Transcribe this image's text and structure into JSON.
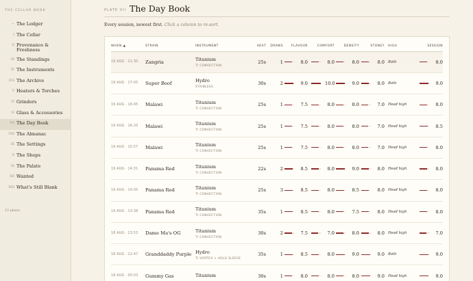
{
  "brand": "THE CELLAR BOOK",
  "nav": [
    {
      "num": "—",
      "label": "The Ledger"
    },
    {
      "num": "I",
      "label": "The Cellar"
    },
    {
      "num": "II",
      "label": "Provenance & Freshness"
    },
    {
      "num": "III",
      "label": "The Standings"
    },
    {
      "num": "IV",
      "label": "The Instruments"
    },
    {
      "num": "IVS",
      "label": "The Archive"
    },
    {
      "num": "V",
      "label": "Heaters & Torches"
    },
    {
      "num": "VI",
      "label": "Grinders"
    },
    {
      "num": "VI",
      "label": "Glass & Accessories"
    },
    {
      "num": "VII",
      "label": "The Day Book",
      "active": true
    },
    {
      "num": "VIII",
      "label": "The Almanac"
    },
    {
      "num": "IX",
      "label": "The Settings"
    },
    {
      "num": "X",
      "label": "The Shops"
    },
    {
      "num": "XI",
      "label": "The Palate"
    },
    {
      "num": "XII",
      "label": "Wanted"
    },
    {
      "num": "XIII",
      "label": "What's Still Blank"
    }
  ],
  "plates_count": "15 plates",
  "header": {
    "plate": "PLATE VII",
    "title": "The Day Book",
    "subtitle": "Every session, newest first.",
    "hint": "Click a column to re-sort."
  },
  "columns": {
    "when": "WHEN ▲",
    "strain": "STRAIN",
    "instrument": "INSTRUMENT",
    "heat": "HEAT",
    "draws": "DRAWS",
    "flavour": "FLAVOUR",
    "comfort": "COMFORT",
    "density": "DENSITY",
    "stoney": "STONEY",
    "high": "HIGH",
    "session": "SESSION"
  },
  "rows": [
    {
      "when": "19 AUG · 21:30",
      "strain": "Zangria",
      "inst": "Titanium",
      "sub": "TI CONVECTION",
      "heat": "25s",
      "draws": "1",
      "flavour": "8.0",
      "comfort": "8.0",
      "density": "8.0",
      "stoney": "8.0",
      "high": "Both",
      "session": "8.0"
    },
    {
      "when": "19 AUG · 17:05",
      "strain": "Super Boof",
      "inst": "Hydro",
      "sub": "STAINLESS",
      "heat": "30s",
      "draws": "2",
      "flavour": "9.0",
      "comfort": "10.0",
      "density": "9.0",
      "stoney": "8.0",
      "high": "Both",
      "session": "9.0"
    },
    {
      "when": "19 AUG · 16:45",
      "strain": "Malawi",
      "inst": "Titanium",
      "sub": "TI CONVECTION",
      "heat": "25s",
      "draws": "1",
      "flavour": "7.5",
      "comfort": "8.0",
      "density": "8.0",
      "stoney": "7.0",
      "high": "Head high",
      "session": "8.0"
    },
    {
      "when": "19 AUG · 16:20",
      "strain": "Malawi",
      "inst": "Titanium",
      "sub": "TI CONVECTION",
      "heat": "25s",
      "draws": "1",
      "flavour": "7.5",
      "comfort": "8.0",
      "density": "8.0",
      "stoney": "7.0",
      "high": "Head high",
      "session": "8.5"
    },
    {
      "when": "19 AUG · 15:57",
      "strain": "Malawi",
      "inst": "Titanium",
      "sub": "TI CONVECTION",
      "heat": "25s",
      "draws": "1",
      "flavour": "7.5",
      "comfort": "8.0",
      "density": "8.0",
      "stoney": "7.0",
      "high": "Head high",
      "session": "8.0"
    },
    {
      "when": "19 AUG · 14:31",
      "strain": "Panama Red",
      "inst": "Titanium",
      "sub": "TI CONVECTION",
      "heat": "22s",
      "draws": "2",
      "flavour": "8.5",
      "comfort": "8.0",
      "density": "9.0",
      "stoney": "8.0",
      "high": "Head high",
      "session": "8.0"
    },
    {
      "when": "19 AUG · 14:05",
      "strain": "Panama Red",
      "inst": "Titanium",
      "sub": "TI CONVECTION",
      "heat": "25s",
      "draws": "3",
      "flavour": "8.5",
      "comfort": "8.0",
      "density": "8.5",
      "stoney": "8.0",
      "high": "Head high",
      "session": "8.0"
    },
    {
      "when": "19 AUG · 13:38",
      "strain": "Panama Red",
      "inst": "Titanium",
      "sub": "TI CONVECTION",
      "heat": "35s",
      "draws": "1",
      "flavour": "8.5",
      "comfort": "8.0",
      "density": "7.5",
      "stoney": "8.0",
      "high": "Head high",
      "session": "8.0"
    },
    {
      "when": "18 AUG · 23:53",
      "strain": "Dame Ma's OG",
      "inst": "Titanium",
      "sub": "TI CONVECTION",
      "heat": "30s",
      "draws": "2",
      "flavour": "7.5",
      "comfort": "7.0",
      "density": "8.0",
      "stoney": "8.0",
      "high": "Head high",
      "session": "7.0"
    },
    {
      "when": "18 AUG · 22:47",
      "strain": "Granddaddy Purple",
      "inst": "Hydro",
      "sub": "TI VORTEX + HOLO SLEEVE",
      "heat": "35s",
      "draws": "1",
      "flavour": "8.5",
      "comfort": "8.0",
      "density": "9.0",
      "stoney": "9.0",
      "high": "Both",
      "session": "9.0"
    },
    {
      "when": "18 AUG · 00:03",
      "strain": "Gummy Gas",
      "inst": "Titanium",
      "sub": "",
      "heat": "30s",
      "draws": "1",
      "flavour": "8.0",
      "comfort": "8.0",
      "density": "8.0",
      "stoney": "9.0",
      "high": "Head high",
      "session": "9.0"
    }
  ],
  "colors": {
    "accent": "#8b2a2a",
    "track": "#eadfd6"
  }
}
